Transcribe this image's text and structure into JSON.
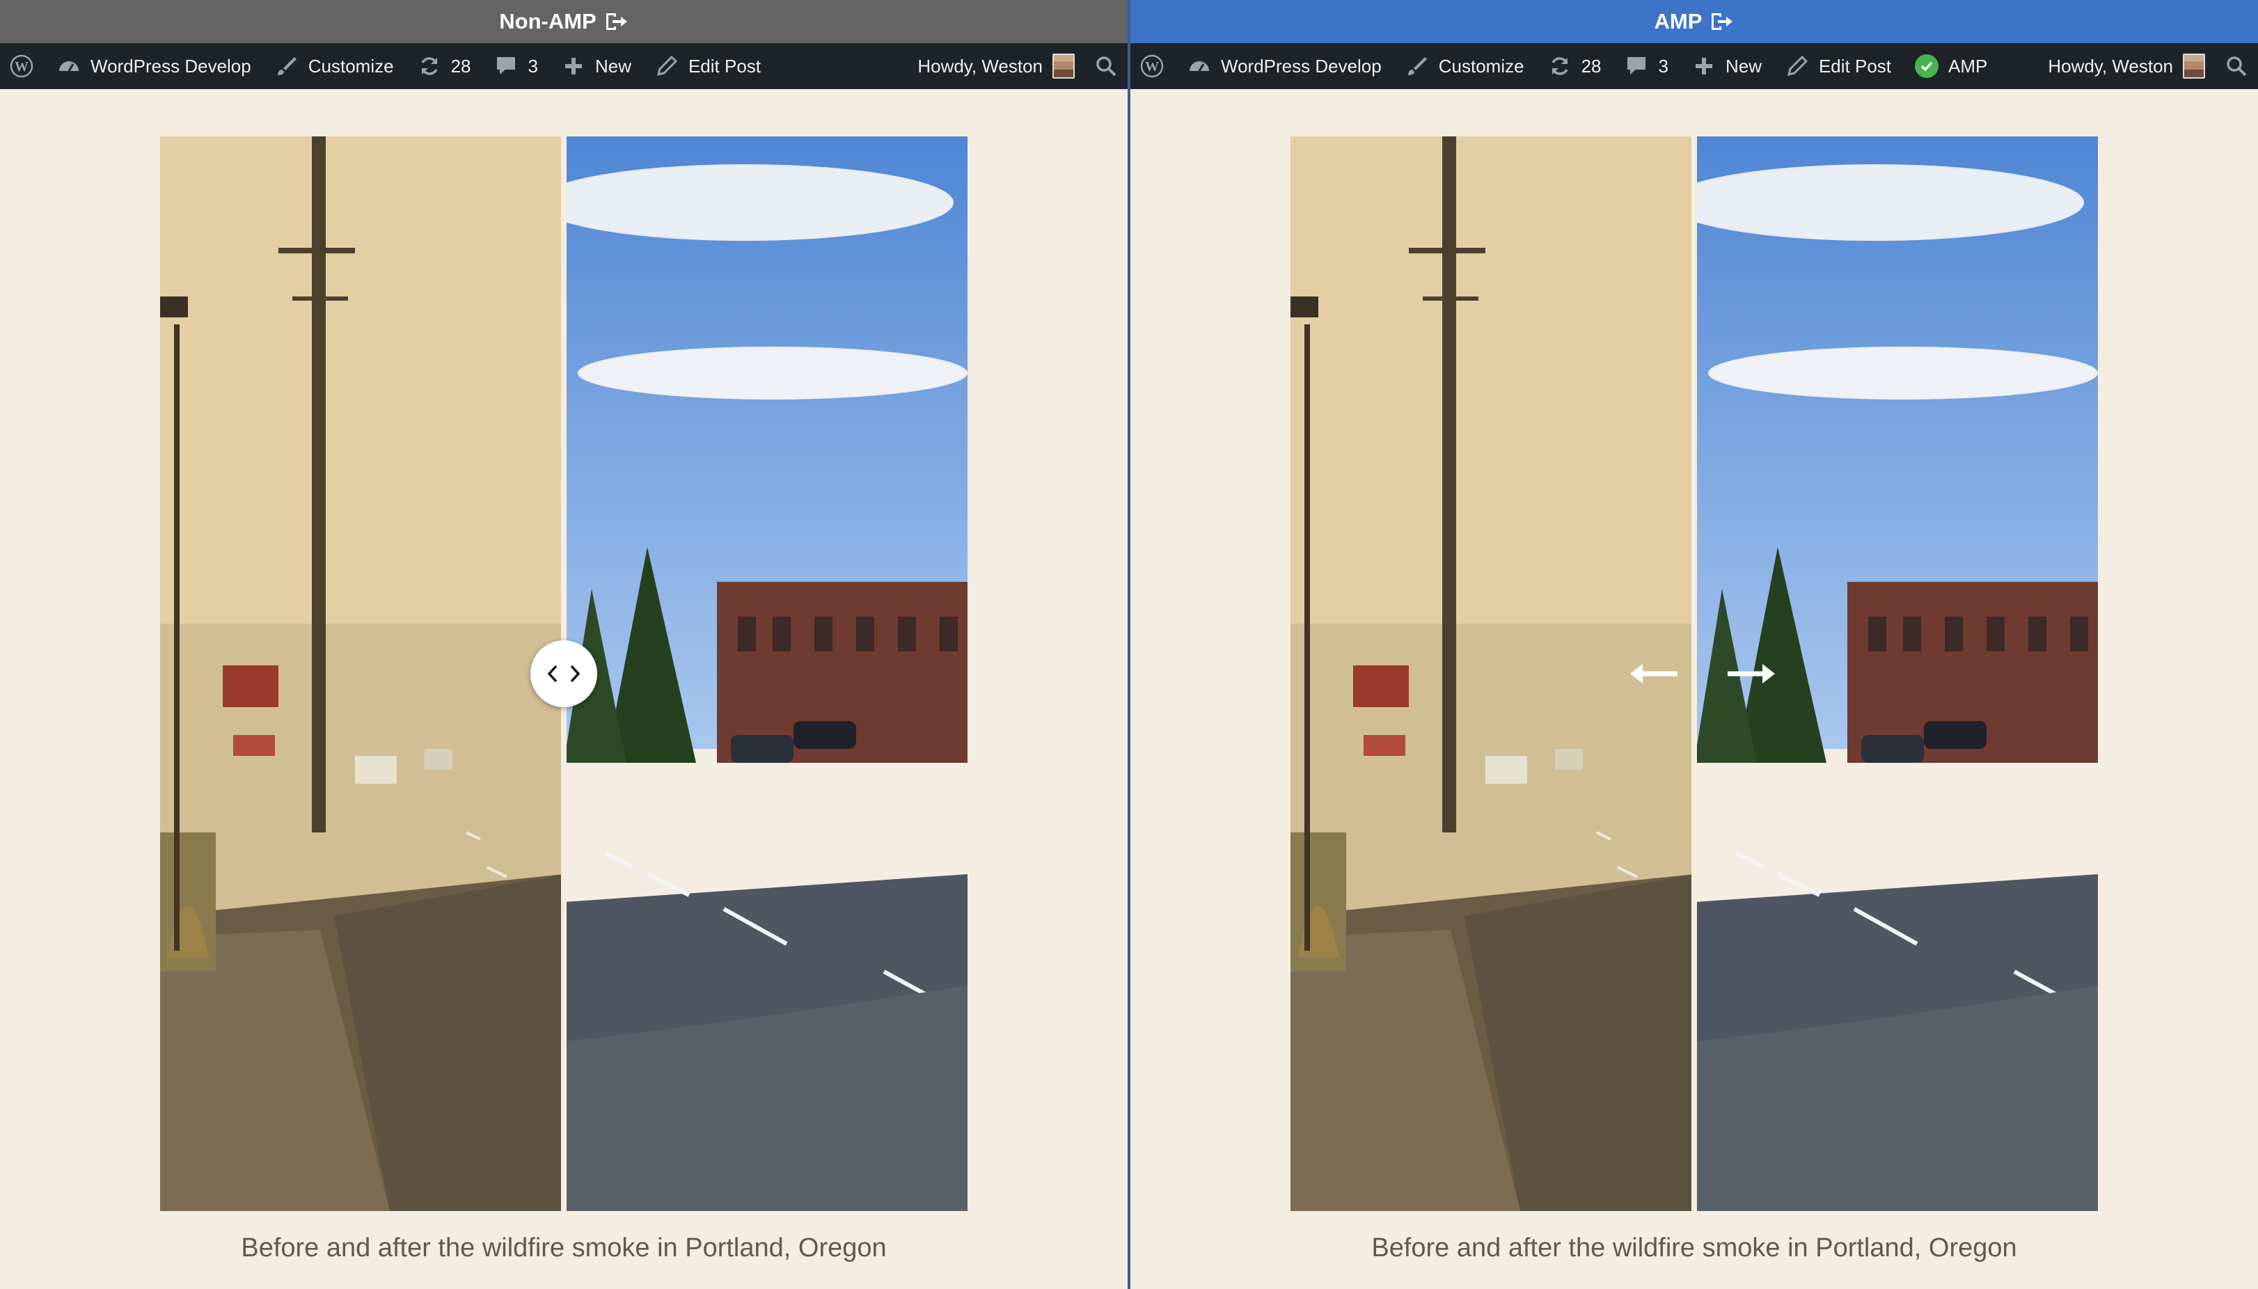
{
  "panes": {
    "left": {
      "title": "Non-AMP",
      "adminbar": {
        "site": "WordPress Develop",
        "customize": "Customize",
        "updates": "28",
        "comments": "3",
        "new": "New",
        "edit": "Edit Post",
        "howdy": "Howdy, Weston"
      },
      "caption": "Before and after the wildfire smoke in Portland, Oregon"
    },
    "right": {
      "title": "AMP",
      "adminbar": {
        "site": "WordPress Develop",
        "customize": "Customize",
        "updates": "28",
        "comments": "3",
        "new": "New",
        "edit": "Edit Post",
        "amp": "AMP",
        "howdy": "Howdy, Weston"
      },
      "caption": "Before and after the wildfire smoke in Portland, Oregon"
    }
  },
  "icons": {
    "wordpress": "wordpress-logo-icon",
    "dashboard": "dashboard-gauge-icon",
    "customize": "paintbrush-icon",
    "updates": "refresh-icon",
    "comments": "comment-bubble-icon",
    "new": "plus-icon",
    "edit": "pencil-icon",
    "amp": "check-circle-icon",
    "search": "search-icon",
    "exit": "exit-arrow-icon"
  },
  "colors": {
    "non_amp_titlebar": "#646464",
    "amp_titlebar": "#3d74c7",
    "adminbar": "#1d2327",
    "page_background": "#f4eee2",
    "caption_text": "#5e5a4c",
    "amp_valid": "#46b450",
    "smoke_sky": "#e6d3a6",
    "clear_sky": "#6a9bd9"
  }
}
